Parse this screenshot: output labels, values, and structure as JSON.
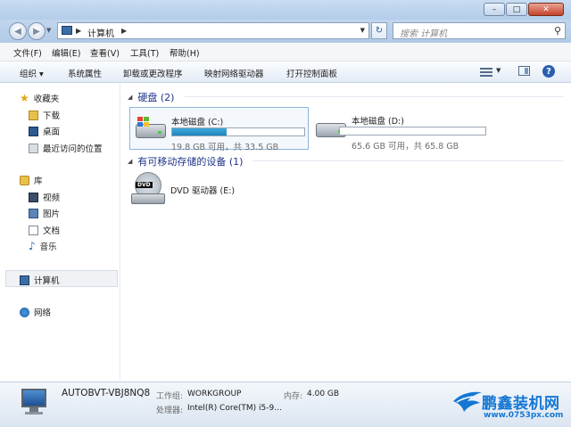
{
  "window": {
    "minimize": "–",
    "maximize": "□",
    "close": "✕"
  },
  "nav": {
    "back": "◀",
    "forward": "▶"
  },
  "address": {
    "path": "计算机"
  },
  "search": {
    "placeholder": "搜索 计算机"
  },
  "menu": [
    "文件(F)",
    "编辑(E)",
    "查看(V)",
    "工具(T)",
    "帮助(H)"
  ],
  "toolbar": [
    "组织 ▾",
    "系统属性",
    "卸载或更改程序",
    "映射网络驱动器",
    "打开控制面板"
  ],
  "toolbar_help": "?",
  "sidebar": {
    "favorites": "收藏夹",
    "favorites_items": [
      "下载",
      "桌面",
      "最近访问的位置"
    ],
    "libraries": "库",
    "libraries_items": [
      "视频",
      "图片",
      "文档",
      "音乐"
    ],
    "computer": "计算机",
    "network": "网络"
  },
  "content": {
    "hdd_group": "硬盘 (2)",
    "drives": [
      {
        "name": "本地磁盘 (C:)",
        "size_text": "19.8 GB 可用，共 33.5 GB",
        "used_fraction": 0.41
      },
      {
        "name": "本地磁盘 (D:)",
        "size_text": "65.6 GB 可用，共 65.8 GB",
        "used_fraction": 0.003
      }
    ],
    "removable_group": "有可移动存储的设备 (1)",
    "dvd_label": "DVD",
    "dvd_name": "DVD 驱动器 (E:)"
  },
  "details": {
    "computer_name": "AUTOBVT-VBJ8NQ8",
    "workgroup_label": "工作组:",
    "workgroup_value": "WORKGROUP",
    "memory_label": "内存:",
    "memory_value": "4.00 GB",
    "processor_label": "处理器:",
    "processor_value": "Intel(R) Core(TM) i5-9..."
  },
  "watermark": {
    "title": "鹏鑫装机网",
    "url": "www.0753px.com"
  },
  "colors": {
    "accent": "#1e3287",
    "bar_fill": "#1d84bd",
    "watermark": "#1577d3"
  }
}
